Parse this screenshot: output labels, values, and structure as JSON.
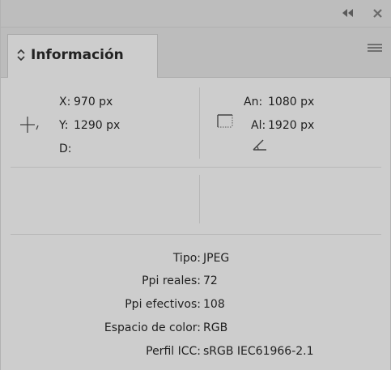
{
  "window": {
    "collapse_glyph": "◂◂",
    "close_glyph": "✕"
  },
  "tab": {
    "label": "Información",
    "chevron": "◇"
  },
  "position": {
    "x_label": "X:",
    "x_value": "970 px",
    "y_label": "Y:",
    "y_value": "1290 px",
    "d_label": "D:"
  },
  "size": {
    "w_label": "An:",
    "w_value": "1080 px",
    "h_label": "Al:",
    "h_value": "1920 px"
  },
  "details": [
    {
      "label": "Tipo:",
      "value": "JPEG"
    },
    {
      "label": "Ppi reales:",
      "value": "72"
    },
    {
      "label": "Ppi efectivos:",
      "value": "108"
    },
    {
      "label": "Espacio de color:",
      "value": "RGB"
    },
    {
      "label": "Perfil ICC:",
      "value": "sRGB IEC61966-2.1"
    }
  ],
  "icons": {
    "crosshair": "crosshair-icon",
    "selection": "selection-size-icon",
    "angle": "angle-icon",
    "menu": "panel-menu-icon"
  }
}
